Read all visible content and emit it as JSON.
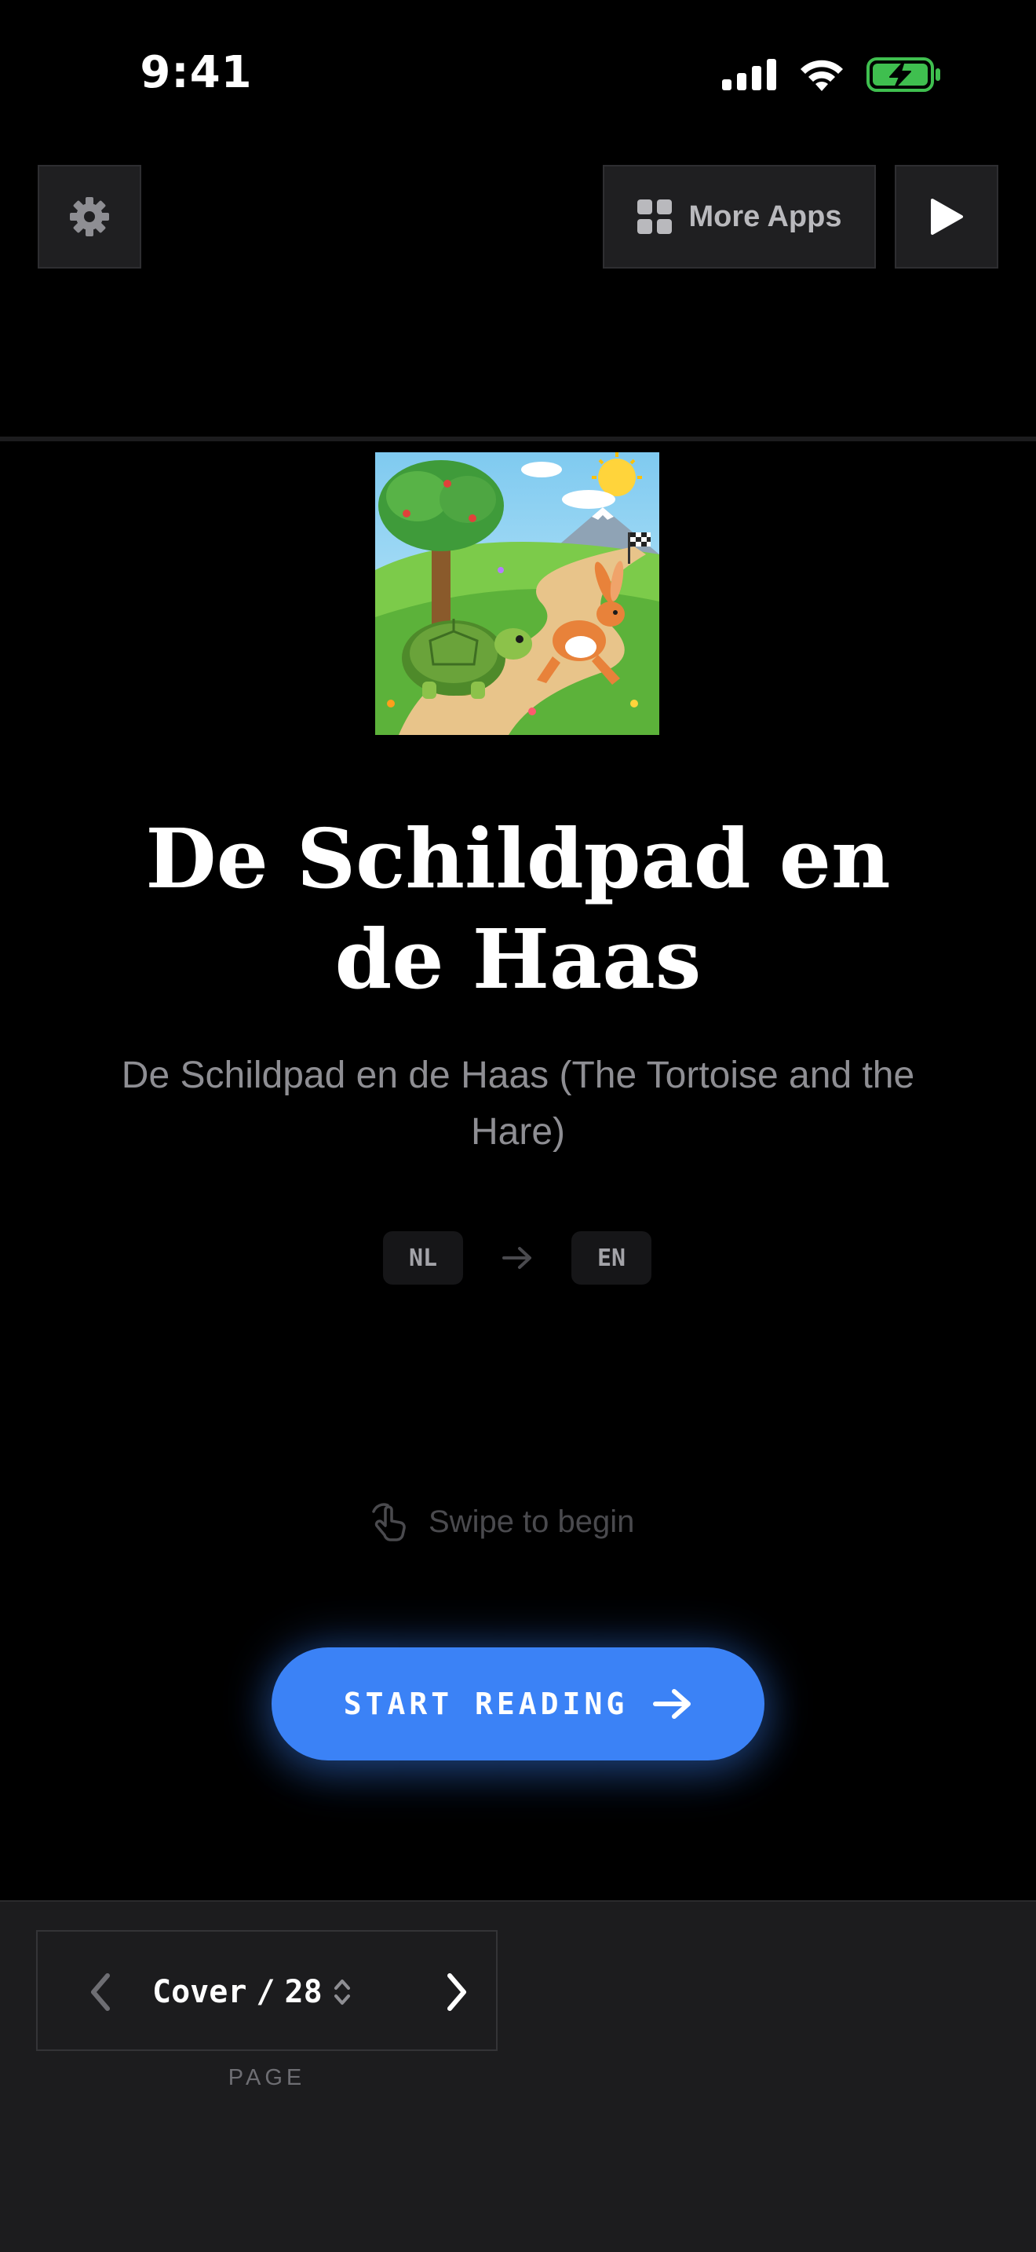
{
  "status_bar": {
    "time": "9:41",
    "icons": [
      "cellular-signal-icon",
      "wifi-icon",
      "battery-charging-icon"
    ]
  },
  "toolbar": {
    "settings_icon": "gear-icon",
    "more_apps_label": "More Apps",
    "more_apps_icon": "grid-icon",
    "play_icon": "play-icon"
  },
  "book": {
    "cover_image": "tortoise-and-hare-illustration",
    "title": "De Schildpad en de Haas",
    "subtitle": "De Schildpad en de Haas (The Tortoise and the Hare)",
    "source_language": "NL",
    "target_language": "EN"
  },
  "hint": {
    "icon": "hand-swipe-icon",
    "text": "Swipe to begin"
  },
  "cta": {
    "label": "START READING",
    "icon": "arrow-right-icon"
  },
  "pager": {
    "current": "Cover",
    "separator": "/",
    "total": "28",
    "caption": "PAGE"
  },
  "colors": {
    "background": "#000000",
    "accent": "#3b82f6",
    "bottom_bar": "#1c1c1e",
    "button_surface": "#1f1f21",
    "muted_text": "#8e8e93"
  }
}
